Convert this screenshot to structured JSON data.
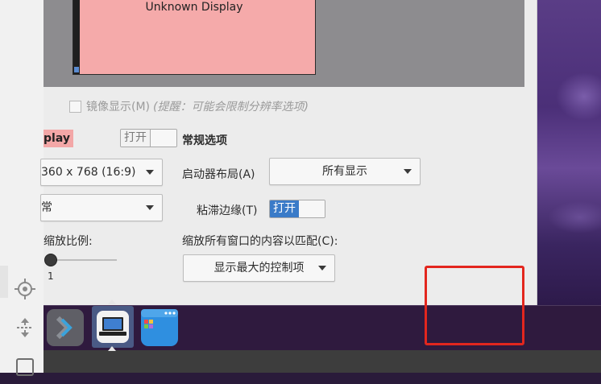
{
  "preview": {
    "monitor_label": "Unknown Display"
  },
  "mirror": {
    "label": "镜像显示(M)",
    "hint": "(提醒：可能会限制分辨率选项)",
    "checked": false
  },
  "display": {
    "name_partial": "play",
    "toggle_label": "打开",
    "toggle_active": false,
    "resolution": "360 x 768 (16:9)",
    "orientation": "常",
    "scale_label": "缩放比例:",
    "scale_value": "1"
  },
  "general": {
    "section_title": "常规选项",
    "launcher_label": "启动器布局(A)",
    "launcher_value": "所有显示",
    "sticky_label": "粘滞边缘(T)",
    "sticky_toggle_label": "打开",
    "sticky_toggle_active": true,
    "scale_all_label": "缩放所有窗口的内容以匹配(C):",
    "panels_value": "显示最大的控制项"
  },
  "left_strip": {
    "icons": [
      "crosshair-icon",
      "fit-arrows-icon",
      "square-icon"
    ]
  },
  "dock": {
    "apps": [
      "terminal-app",
      "display-settings-app",
      "file-manager-app"
    ]
  },
  "colors": {
    "accent": "#3a7bc8",
    "monitor_fill": "#f5aaaa",
    "dock_bg": "#2f1a3e",
    "highlight": "#e3261e"
  }
}
